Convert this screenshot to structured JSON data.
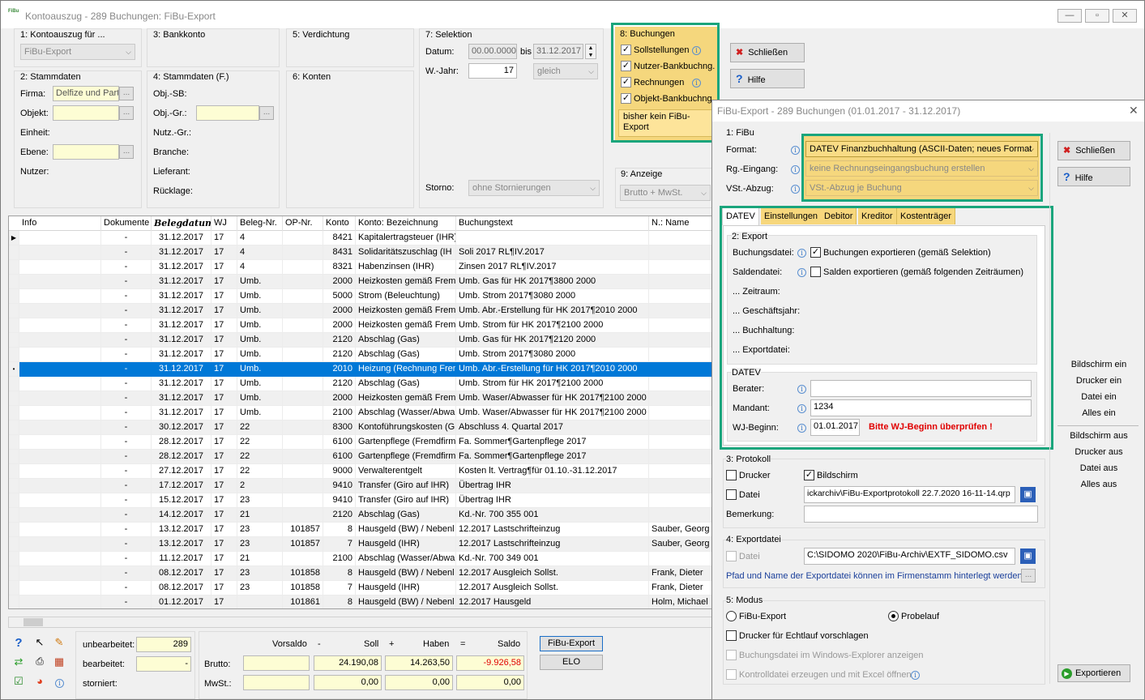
{
  "window": {
    "title": "Kontoauszug - 289 Buchungen:  FiBu-Export",
    "icon_text": "FiBu"
  },
  "top": {
    "g1_label": "1: Kontoauszug für ...",
    "g1_combo": "FiBu-Export",
    "g2_label": "2: Stammdaten",
    "firma_label": "Firma:",
    "firma_value": "Delfize und Part",
    "objekt_label": "Objekt:",
    "einheit_label": "Einheit:",
    "ebene_label": "Ebene:",
    "nutzer_label": "Nutzer:",
    "g3_label": "3: Bankkonto",
    "g4_label": "4: Stammdaten (F.)",
    "objsb_label": "Obj.-SB:",
    "objgr_label": "Obj.-Gr.:",
    "nutzgr_label": "Nutz.-Gr.:",
    "branche_label": "Branche:",
    "lieferant_label": "Lieferant:",
    "ruecklage_label": "Rücklage:",
    "g5_label": "5: Verdichtung",
    "g6_label": "6: Konten",
    "g7_label": "7: Selektion",
    "datum_label": "Datum:",
    "datum_from": "00.00.0000",
    "bis_label": "bis",
    "datum_to": "31.12.2017",
    "wjahr_label": "W.-Jahr:",
    "wjahr_value": "17",
    "gleich_combo": "gleich",
    "storno_label": "Storno:",
    "storno_combo": "ohne Stornierungen",
    "g8_label": "8: Buchungen",
    "opt_soll": "Sollstellungen",
    "opt_nutzer": "Nutzer-Bankbuchng.",
    "opt_rechn": "Rechnungen",
    "opt_objekt": "Objekt-Bankbuchng.",
    "note": "bisher kein FiBu-Export",
    "g9_label": "9: Anzeige",
    "anzeige_combo": "Brutto + MwSt.",
    "schliessen": "Schließen",
    "hilfe": "Hilfe"
  },
  "grid": {
    "columns": [
      "Info",
      "Dokumente",
      "Belegdatum",
      "WJ",
      "Beleg-Nr.",
      "OP-Nr.",
      "Konto",
      "Konto: Bezeichnung",
      "Buchungstext",
      "N.: Name"
    ],
    "rows": [
      [
        "",
        "-",
        "31.12.2017",
        "17",
        "4",
        "",
        "8421",
        "Kapitalertragsteuer (IHR)",
        "",
        ""
      ],
      [
        "",
        "-",
        "31.12.2017",
        "17",
        "4",
        "",
        "8431",
        "Solidaritätszuschlag (IH",
        "Soli 2017 RL¶IV.2017",
        ""
      ],
      [
        "",
        "-",
        "31.12.2017",
        "17",
        "4",
        "",
        "8321",
        "Habenzinsen (IHR)",
        "Zinsen 2017 RL¶IV.2017",
        ""
      ],
      [
        "",
        "-",
        "31.12.2017",
        "17",
        "Umb.",
        "",
        "2000",
        "Heizkosten gemäß Fremd",
        "Umb. Gas für HK 2017¶3800 2000",
        ""
      ],
      [
        "",
        "-",
        "31.12.2017",
        "17",
        "Umb.",
        "",
        "5000",
        "Strom (Beleuchtung)",
        "Umb. Strom  2017¶3080 2000",
        ""
      ],
      [
        "",
        "-",
        "31.12.2017",
        "17",
        "Umb.",
        "",
        "2000",
        "Heizkosten gemäß Fremd",
        "Umb. Abr.-Erstellung für HK 2017¶2010 2000",
        ""
      ],
      [
        "",
        "-",
        "31.12.2017",
        "17",
        "Umb.",
        "",
        "2000",
        "Heizkosten gemäß Fremd",
        "Umb. Strom für HK 2017¶2100 2000",
        ""
      ],
      [
        "",
        "-",
        "31.12.2017",
        "17",
        "Umb.",
        "",
        "2120",
        "Abschlag (Gas)",
        "Umb. Gas für HK 2017¶2120 2000",
        ""
      ],
      [
        "",
        "-",
        "31.12.2017",
        "17",
        "Umb.",
        "",
        "2120",
        "Abschlag (Gas)",
        "Umb. Strom  2017¶3080 2000",
        ""
      ],
      [
        "",
        "-",
        "31.12.2017",
        "17",
        "Umb.",
        "",
        "2010",
        "Heizung (Rechnung Frem",
        "Umb. Abr.-Erstellung für HK 2017¶2010 2000",
        ""
      ],
      [
        "",
        "-",
        "31.12.2017",
        "17",
        "Umb.",
        "",
        "2120",
        "Abschlag (Gas)",
        "Umb. Strom für HK 2017¶2100 2000",
        ""
      ],
      [
        "",
        "-",
        "31.12.2017",
        "17",
        "Umb.",
        "",
        "2000",
        "Heizkosten gemäß Fremd",
        "Umb. Waser/Abwasser für HK 2017¶2100 2000",
        ""
      ],
      [
        "",
        "-",
        "31.12.2017",
        "17",
        "Umb.",
        "",
        "2100",
        "Abschlag (Wasser/Abwa",
        "Umb. Waser/Abwasser für HK 2017¶2100 2000",
        ""
      ],
      [
        "",
        "-",
        "30.12.2017",
        "17",
        "22",
        "",
        "8300",
        "Kontoführungskosten (Gi",
        "Abschluss 4. Quartal 2017",
        ""
      ],
      [
        "",
        "-",
        "28.12.2017",
        "17",
        "22",
        "",
        "6100",
        "Gartenpflege (Fremdfirma",
        "Fa. Sommer¶Gartenpflege 2017",
        ""
      ],
      [
        "",
        "-",
        "28.12.2017",
        "17",
        "22",
        "",
        "6100",
        "Gartenpflege (Fremdfirma",
        "Fa. Sommer¶Gartenpflege 2017",
        ""
      ],
      [
        "",
        "-",
        "27.12.2017",
        "17",
        "22",
        "",
        "9000",
        "Verwalterentgelt",
        "Kosten lt. Vertrag¶für 01.10.-31.12.2017",
        ""
      ],
      [
        "",
        "-",
        "17.12.2017",
        "17",
        "2",
        "",
        "9410",
        "Transfer (Giro auf IHR)",
        "Übertrag IHR",
        ""
      ],
      [
        "",
        "-",
        "15.12.2017",
        "17",
        "23",
        "",
        "9410",
        "Transfer (Giro auf IHR)",
        "Übertrag IHR",
        ""
      ],
      [
        "",
        "-",
        "14.12.2017",
        "17",
        "21",
        "",
        "2120",
        "Abschlag (Gas)",
        "Kd.-Nr. 700 355 001",
        ""
      ],
      [
        "",
        "-",
        "13.12.2017",
        "17",
        "23",
        "101857",
        "8",
        "Hausgeld (BW) / Nebenl",
        "12.2017 Lastschrifteinzug",
        "Sauber, Georg"
      ],
      [
        "",
        "-",
        "13.12.2017",
        "17",
        "23",
        "101857",
        "7",
        "Hausgeld (IHR)",
        "12.2017 Lastschrifteinzug",
        "Sauber, Georg"
      ],
      [
        "",
        "-",
        "11.12.2017",
        "17",
        "21",
        "",
        "2100",
        "Abschlag (Wasser/Abwa",
        "Kd.-Nr. 700 349 001",
        ""
      ],
      [
        "",
        "-",
        "08.12.2017",
        "17",
        "23",
        "101858",
        "8",
        "Hausgeld (BW) / Nebenl",
        "12.2017 Ausgleich Sollst.",
        "Frank, Dieter"
      ],
      [
        "",
        "-",
        "08.12.2017",
        "17",
        "23",
        "101858",
        "7",
        "Hausgeld (IHR)",
        "12.2017 Ausgleich Sollst.",
        "Frank, Dieter"
      ],
      [
        "",
        "-",
        "01.12.2017",
        "17",
        "",
        "101861",
        "8",
        "Hausgeld (BW) / Nebenl",
        "12.2017 Hausgeld",
        "Holm, Michael"
      ]
    ],
    "selected_row": 9
  },
  "footer": {
    "unbearbeitet_label": "unbearbeitet:",
    "unbearbeitet_value": "289",
    "bearbeitet_label": "bearbeitet:",
    "bearbeitet_value": "-",
    "storniert_label": "storniert:",
    "vorsaldo": "Vorsaldo",
    "minus": "-",
    "soll": "Soll",
    "plus": "+",
    "haben": "Haben",
    "eq": "=",
    "saldo": "Saldo",
    "brutto_label": "Brutto:",
    "mwst_label": "MwSt.:",
    "brutto_soll": "24.190,08",
    "brutto_haben": "14.263,50",
    "brutto_saldo": "-9.926,58",
    "mwst_soll": "0,00",
    "mwst_haben": "0,00",
    "mwst_saldo": "0,00",
    "fibu_export_btn": "FiBu-Export",
    "elo_btn": "ELO"
  },
  "dialog": {
    "title": "FiBu-Export - 289 Buchungen (01.01.2017 - 31.12.2017)",
    "s1": "1: FiBu",
    "format_label": "Format:",
    "format_value": "DATEV Finanzbuchhaltung (ASCII-Daten; neues Format",
    "rg_label": "Rg.-Eingang:",
    "rg_value": "keine Rechnungseingangsbuchung erstellen",
    "vst_label": "VSt.-Abzug:",
    "vst_value": "VSt.-Abzug je Buchung",
    "tabs": [
      "DATEV",
      "Einstellungen",
      "Debitor",
      "Kreditor",
      "Kostenträger"
    ],
    "s2": "2: Export",
    "buchungsdatei_label": "Buchungsdatei:",
    "buchungen_export": "Buchungen exportieren (gemäß Selektion)",
    "saldendatei_label": "Saldendatei:",
    "salden_export": "Salden exportieren (gemäß folgenden Zeiträumen)",
    "zeitraum": "... Zeitraum:",
    "gj": "... Geschäftsjahr:",
    "buchhaltung": "... Buchhaltung:",
    "exportdatei": "... Exportdatei:",
    "datev_label": "DATEV",
    "berater_label": "Berater:",
    "mandant_label": "Mandant:",
    "mandant_value": "1234",
    "wj_label": "WJ-Beginn:",
    "wj_value": "01.01.2017",
    "wj_warning": "Bitte WJ-Beginn überprüfen !",
    "s3": "3: Protokoll",
    "drucker": "Drucker",
    "bildschirm": "Bildschirm",
    "datei": "Datei",
    "protokoll_path": "ickarchiv\\FiBu-Exportprotokoll 22.7.2020 16-11-14.qrp",
    "bemerkung_label": "Bemerkung:",
    "s4": "4: Exportdatei",
    "export_path": "C:\\SIDOMO 2020\\FiBu-Archiv\\EXTF_SIDOMO.csv",
    "path_hint": "Pfad und Name der Exportdatei können im Firmenstamm hinterlegt werden.",
    "s5": "5: Modus",
    "fibu_export": "FiBu-Export",
    "probelauf": "Probelauf",
    "drucker_echtlauf": "Drucker für Echtlauf vorschlagen",
    "explorer": "Buchungsdatei im Windows-Explorer anzeigen",
    "kontroll": "Kontrolldatei erzeugen und mit Excel öffnen",
    "schliessen": "Schließen",
    "hilfe": "Hilfe",
    "side_links": [
      "Bildschirm ein",
      "Drucker ein",
      "Datei ein",
      "Alles ein",
      "Bildschirm aus",
      "Drucker aus",
      "Datei aus",
      "Alles aus"
    ],
    "exportieren": "Exportieren"
  },
  "colors": {
    "selection": "#0078d7",
    "highlight_green": "#1aa57c",
    "panel_yellow": "#f5d77d",
    "red": "#e00000"
  }
}
